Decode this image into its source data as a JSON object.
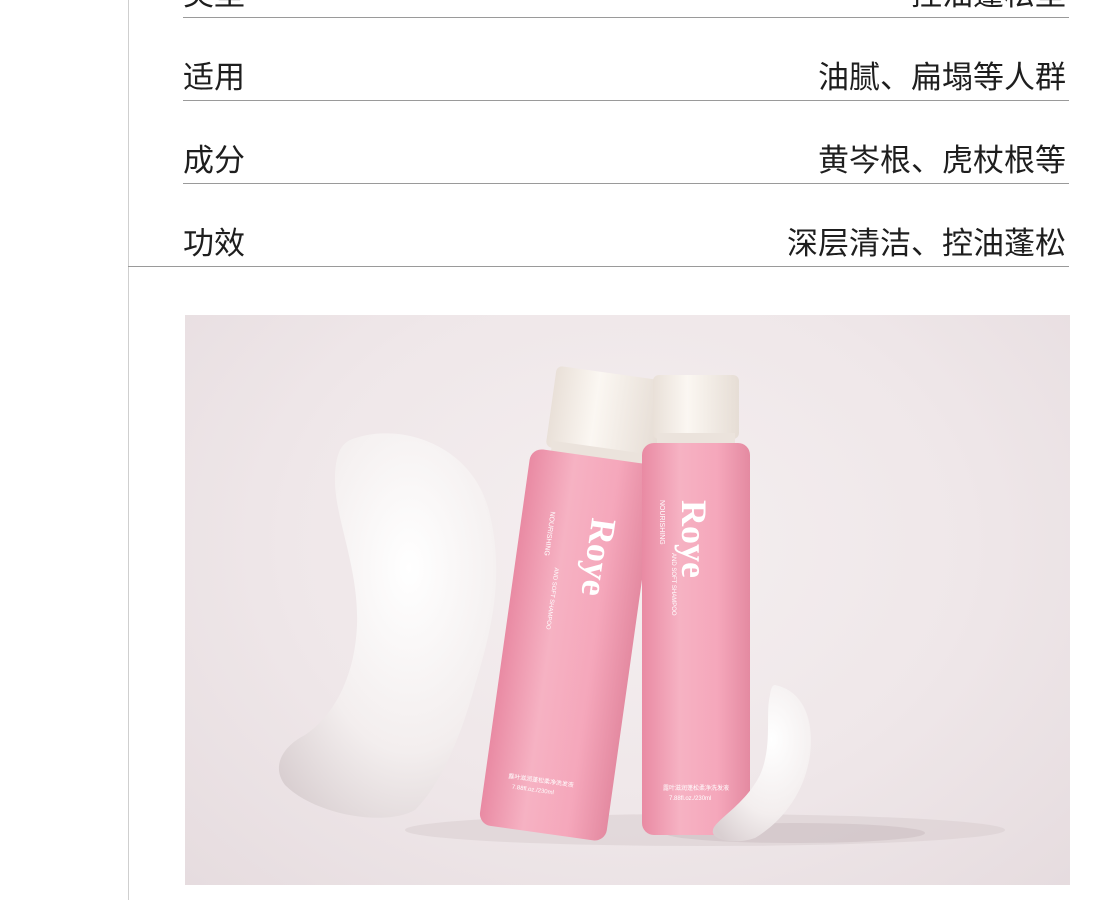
{
  "specs": [
    {
      "label": "类型",
      "value": "控油蓬松型"
    },
    {
      "label": "适用",
      "value": "油腻、扁塌等人群"
    },
    {
      "label": "成分",
      "value": "黄岑根、虎杖根等"
    },
    {
      "label": "功效",
      "value": "深层清洁、控油蓬松"
    }
  ],
  "product": {
    "brand": "Roye",
    "line": "NOURISHING",
    "subline": "AND SOFT SHAMPOO",
    "cn_name": "露叶滋润蓬松柔净洗发液",
    "volume": "7.88fl.oz./230ml"
  },
  "colors": {
    "bottle": "#f4a9bd",
    "cap": "#f7f1ea",
    "background": "#f1eaec"
  }
}
